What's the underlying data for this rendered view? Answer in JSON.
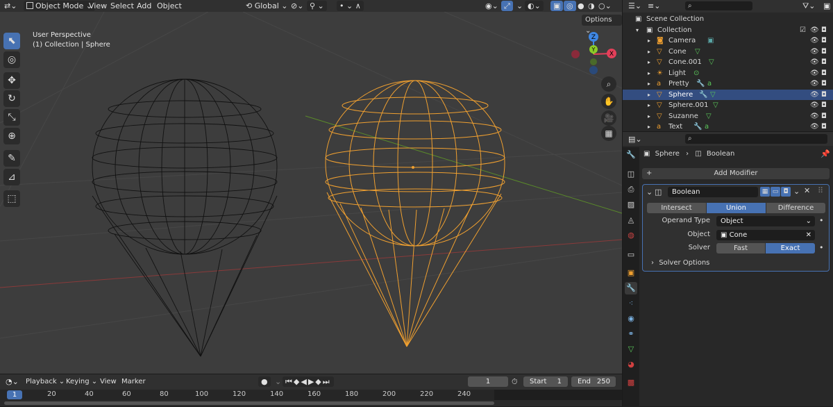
{
  "header": {
    "editor_type_icon": "view3d-icon",
    "mode": "Object Mode",
    "menus": [
      "View",
      "Select",
      "Add",
      "Object"
    ],
    "orientation": "Global",
    "options_label": "Options"
  },
  "viewport": {
    "info_line1": "User Perspective",
    "info_line2": "(1) Collection | Sphere",
    "gizmo": {
      "z": "Z",
      "y": "Y",
      "x": "X"
    }
  },
  "outliner": {
    "search_placeholder": "",
    "items": [
      {
        "label": "Scene Collection",
        "depth": 0,
        "icon": "scene-collection-icon"
      },
      {
        "label": "Collection",
        "depth": 1,
        "icon": "collection-icon"
      },
      {
        "label": "Camera",
        "depth": 2,
        "icon": "camera-icon"
      },
      {
        "label": "Cone",
        "depth": 2,
        "icon": "mesh-icon"
      },
      {
        "label": "Cone.001",
        "depth": 2,
        "icon": "mesh-icon"
      },
      {
        "label": "Light",
        "depth": 2,
        "icon": "light-icon"
      },
      {
        "label": "Pretty",
        "depth": 2,
        "icon": "text-icon"
      },
      {
        "label": "Sphere",
        "depth": 2,
        "icon": "mesh-icon",
        "selected": true
      },
      {
        "label": "Sphere.001",
        "depth": 2,
        "icon": "mesh-icon"
      },
      {
        "label": "Suzanne",
        "depth": 2,
        "icon": "mesh-icon"
      },
      {
        "label": "Text",
        "depth": 2,
        "icon": "text-icon"
      }
    ]
  },
  "properties": {
    "breadcrumb_object": "Sphere",
    "breadcrumb_modifier": "Boolean",
    "add_modifier": "Add Modifier",
    "modifier_name": "Boolean",
    "operations": [
      "Intersect",
      "Union",
      "Difference"
    ],
    "active_operation": "Union",
    "operand_type_label": "Operand Type",
    "operand_type_value": "Object",
    "object_label": "Object",
    "object_value": "Cone",
    "solver_label": "Solver",
    "solver_options": [
      "Fast",
      "Exact"
    ],
    "active_solver": "Exact",
    "solver_options_panel": "Solver Options"
  },
  "timeline": {
    "menus": [
      "Playback",
      "Keying",
      "View",
      "Marker"
    ],
    "current_frame": "1",
    "start_label": "Start",
    "start_value": "1",
    "end_label": "End",
    "end_value": "250",
    "ruler_marks": [
      "1",
      "20",
      "40",
      "60",
      "80",
      "100",
      "120",
      "140",
      "160",
      "180",
      "200",
      "220",
      "240"
    ]
  },
  "colors": {
    "accent": "#4772b3",
    "selected_wire": "#f0a030",
    "wire": "#111111",
    "x_axis": "#e4405a",
    "y_axis": "#8ccc28",
    "z_axis": "#3f87e4"
  }
}
